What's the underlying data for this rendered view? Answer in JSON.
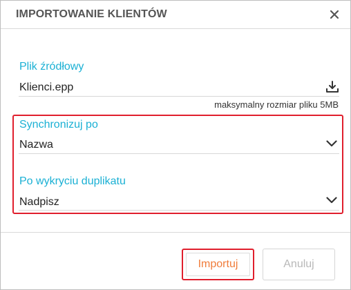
{
  "dialog": {
    "title": "IMPORTOWANIE KLIENTÓW"
  },
  "source_file": {
    "label": "Plik źródłowy",
    "value": "Klienci.epp",
    "hint": "maksymalny rozmiar pliku 5MB"
  },
  "sync_by": {
    "label": "Synchronizuj po",
    "value": "Nazwa"
  },
  "on_duplicate": {
    "label": "Po wykryciu duplikatu",
    "value": "Nadpisz"
  },
  "buttons": {
    "import_label": "Importuj",
    "cancel_label": "Anuluj"
  },
  "colors": {
    "accent": "#1ab0d4",
    "import_text": "#f07c3a",
    "highlight": "#e01e2c",
    "disabled_text": "#b8b8b8"
  },
  "icons": {
    "close": "close-icon",
    "upload": "upload-icon",
    "chevron": "chevron-down-icon"
  }
}
